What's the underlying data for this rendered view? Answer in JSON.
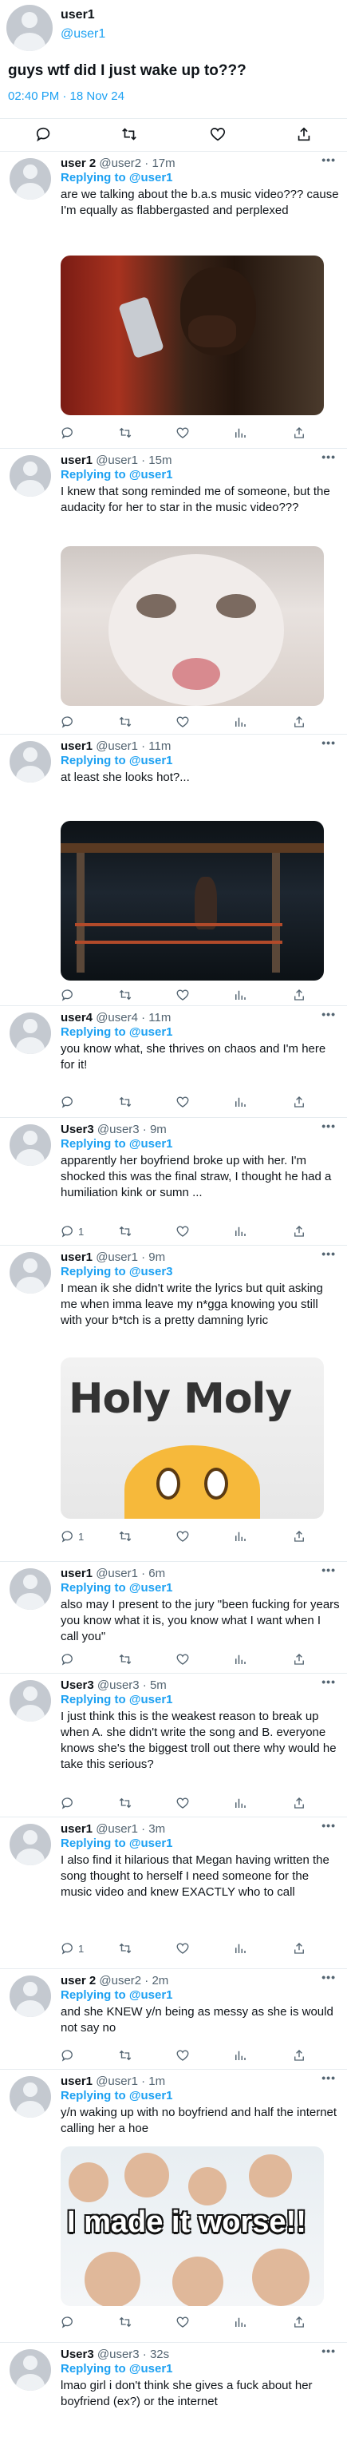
{
  "main_tweet": {
    "name": "user1",
    "handle": "@user1",
    "text": "guys wtf did I just wake up to???",
    "timestamp": "02:40 PM · 18 Nov 24"
  },
  "replies": [
    {
      "name": "user 2",
      "handle": "@user2",
      "time": "17m",
      "replying_label": "Replying to",
      "replying_to": "@user1",
      "text": "are we talking about the b.a.s music video??? cause I'm equally as flabbergasted and perplexed",
      "counts": {
        "replies": "",
        "retweets": "",
        "likes": ""
      }
    },
    {
      "name": "user1",
      "handle": "@user1",
      "time": "15m",
      "replying_label": "Replying to",
      "replying_to": "@user1",
      "text": "I knew that song reminded me of someone, but the audacity for her to star in the music video???",
      "counts": {
        "replies": "",
        "retweets": "",
        "likes": ""
      }
    },
    {
      "name": "user1",
      "handle": "@user1",
      "time": "11m",
      "replying_label": "Replying to",
      "replying_to": "@user1",
      "text": "at least she looks hot?...",
      "counts": {
        "replies": "",
        "retweets": "",
        "likes": ""
      }
    },
    {
      "name": "user4",
      "handle": "@user4",
      "time": "11m",
      "replying_label": "Replying to",
      "replying_to": "@user1",
      "text": "you know what, she thrives on chaos and I'm here for it!",
      "counts": {
        "replies": "",
        "retweets": "",
        "likes": ""
      }
    },
    {
      "name": "User3",
      "handle": "@user3",
      "time": "9m",
      "replying_label": "Replying to",
      "replying_to": "@user1",
      "text": "apparently her boyfriend broke up with her. I'm shocked this was the final straw, I thought he had a humiliation kink or sumn ...",
      "counts": {
        "replies": "1",
        "retweets": "",
        "likes": ""
      }
    },
    {
      "name": "user1",
      "handle": "@user1",
      "time": "9m",
      "replying_label": "Replying to",
      "replying_to": "@user3",
      "text": "I mean ik she didn't write the lyrics but quit asking me when imma leave my n*gga knowing you still with your b*tch is a pretty damning lyric",
      "counts": {
        "replies": "1",
        "retweets": "",
        "likes": ""
      }
    },
    {
      "name": "user1",
      "handle": "@user1",
      "time": "6m",
      "replying_label": "Replying to",
      "replying_to": "@user1",
      "text": "also may I present to the jury \"been fucking for years you know what it is, you know what I want when I call you\"",
      "counts": {
        "replies": "",
        "retweets": "",
        "likes": ""
      }
    },
    {
      "name": "User3",
      "handle": "@user3",
      "time": "5m",
      "replying_label": "Replying to",
      "replying_to": "@user1",
      "text": "I just think this is the weakest reason to break up when A. she didn't write the song and B. everyone knows she's the biggest troll out there why would he take this serious?",
      "counts": {
        "replies": "",
        "retweets": "",
        "likes": ""
      }
    },
    {
      "name": "user1",
      "handle": "@user1",
      "time": "3m",
      "replying_label": "Replying to",
      "replying_to": "@user1",
      "text": "I also find it hilarious that Megan having written the song thought to herself I need someone for the music video and knew EXACTLY who to call",
      "counts": {
        "replies": "1",
        "retweets": "",
        "likes": ""
      }
    },
    {
      "name": "user 2",
      "handle": "@user2",
      "time": "2m",
      "replying_label": "Replying to",
      "replying_to": "@user1",
      "text": "and she KNEW y/n being as messy as she is would not say no",
      "counts": {
        "replies": "",
        "retweets": "",
        "likes": ""
      }
    },
    {
      "name": "user1",
      "handle": "@user1",
      "time": "1m",
      "replying_label": "Replying to",
      "replying_to": "@user1",
      "text": "y/n waking up with no boyfriend and half the internet calling her a hoe",
      "counts": {
        "replies": "",
        "retweets": "",
        "likes": ""
      }
    },
    {
      "name": "User3",
      "handle": "@user3",
      "time": "32s",
      "replying_label": "Replying to",
      "replying_to": "@user1",
      "text": "lmao girl i don't think she gives a fuck about her boyfriend (ex?) or the internet",
      "counts": {
        "replies": "",
        "retweets": "",
        "likes": ""
      }
    }
  ],
  "media": {
    "holy_moly_text": "Holy Moly",
    "worse_text": "I made it worse!!"
  },
  "icons": {
    "reply": "comment-icon",
    "retweet": "retweet-icon",
    "like": "heart-icon",
    "views": "views-icon",
    "share": "share-icon",
    "more": "more-icon"
  },
  "colors": {
    "accent": "#1da1f2",
    "muted": "#536471",
    "divider": "#e6ecf0"
  }
}
